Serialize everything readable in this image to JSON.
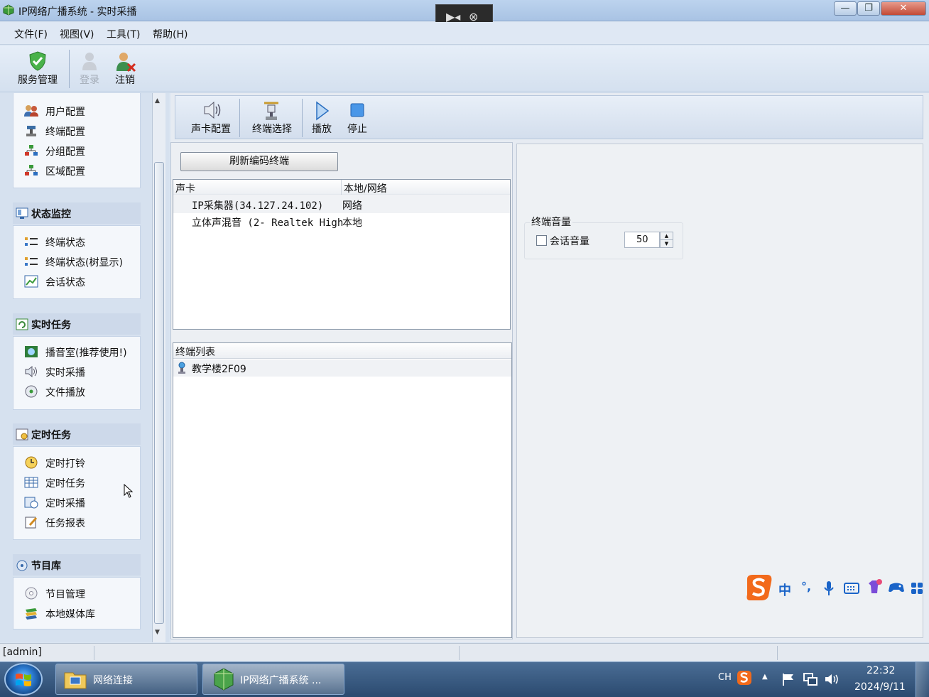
{
  "window": {
    "title": "IP网络广播系统  -  实时采播",
    "minimize": "—",
    "restore": "❐",
    "close": "✕"
  },
  "remote_bar": {
    "collapse_icon": "▶◂",
    "close_icon": "⊗"
  },
  "menu": [
    "文件(F)",
    "视图(V)",
    "工具(T)",
    "帮助(H)"
  ],
  "toolbar": {
    "service_mgmt": "服务管理",
    "login": "登录",
    "logout": "注销"
  },
  "sidebar": {
    "top_items": [
      "用户配置",
      "终端配置",
      "分组配置",
      "区域配置"
    ],
    "sections": [
      {
        "title": "状态监控",
        "items": [
          "终端状态",
          "终端状态(树显示)",
          "会话状态"
        ]
      },
      {
        "title": "实时任务",
        "items": [
          "播音室(推荐使用!)",
          "实时采播",
          "文件播放"
        ]
      },
      {
        "title": "定时任务",
        "items": [
          "定时打铃",
          "定时任务",
          "定时采播",
          "任务报表"
        ]
      },
      {
        "title": "节目库",
        "items": [
          "节目管理",
          "本地媒体库"
        ]
      }
    ]
  },
  "content_toolbar": {
    "sound_card_config": "声卡配置",
    "terminal_select": "终端选择",
    "play": "播放",
    "stop": "停止"
  },
  "refresh_button": "刷新编码终端",
  "sound_card_list": {
    "headers": [
      "声卡",
      "本地/网络"
    ],
    "rows": [
      {
        "name": "IP采集器(34.127.24.102)",
        "type": "网络"
      },
      {
        "name": "立体声混音 (2- Realtek High",
        "type": "本地"
      }
    ]
  },
  "terminal_list": {
    "header": "终端列表",
    "rows": [
      "教学楼2F09"
    ]
  },
  "terminal_volume": {
    "group_title": "终端音量",
    "checkbox_label": "会话音量",
    "checked": false,
    "value": "50"
  },
  "statusbar": {
    "user": "[admin]"
  },
  "taskbar": {
    "items": [
      "网络连接",
      "IP网络广播系统 ..."
    ],
    "lang": "CH",
    "time": "22:32",
    "date": "2024/9/11"
  },
  "ime": {
    "mode": "中",
    "punct": "°,"
  }
}
